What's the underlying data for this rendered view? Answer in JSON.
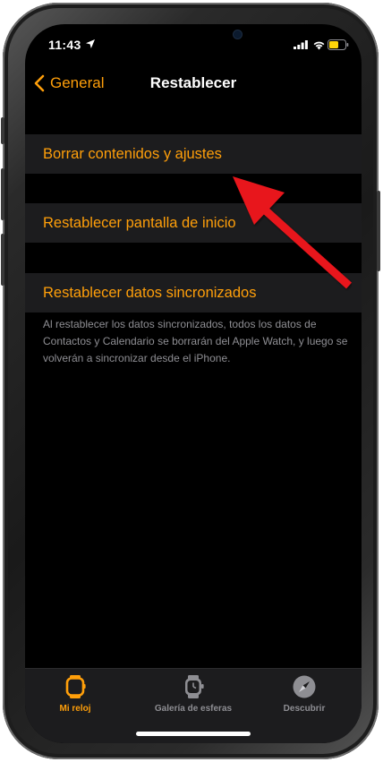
{
  "status_bar": {
    "time": "11:43",
    "icons": [
      "location-arrow-icon",
      "signal-bars-icon",
      "wifi-icon",
      "battery-icon"
    ]
  },
  "nav": {
    "back_label": "General",
    "title": "Restablecer"
  },
  "cells": [
    {
      "label": "Borrar contenidos y ajustes"
    },
    {
      "label": "Restablecer pantalla de inicio"
    },
    {
      "label": "Restablecer datos sincronizados"
    }
  ],
  "footer_note": "Al restablecer los datos sincronizados, todos los datos de Contactos y Calendario se borrarán del Apple Watch, y luego se volverán a sincronizar desde el iPhone.",
  "tabs": [
    {
      "label": "Mi reloj",
      "icon": "watch-icon",
      "active": true
    },
    {
      "label": "Galería de esferas",
      "icon": "watch-face-icon",
      "active": false
    },
    {
      "label": "Descubrir",
      "icon": "compass-icon",
      "active": false
    }
  ],
  "colors": {
    "accent": "#ff9f0a",
    "cell_background": "#1c1c1e",
    "background": "#000000",
    "secondary_text": "#8e8e93",
    "inactive_tab": "#8e8e93",
    "annotation_arrow": "#e8141b"
  }
}
